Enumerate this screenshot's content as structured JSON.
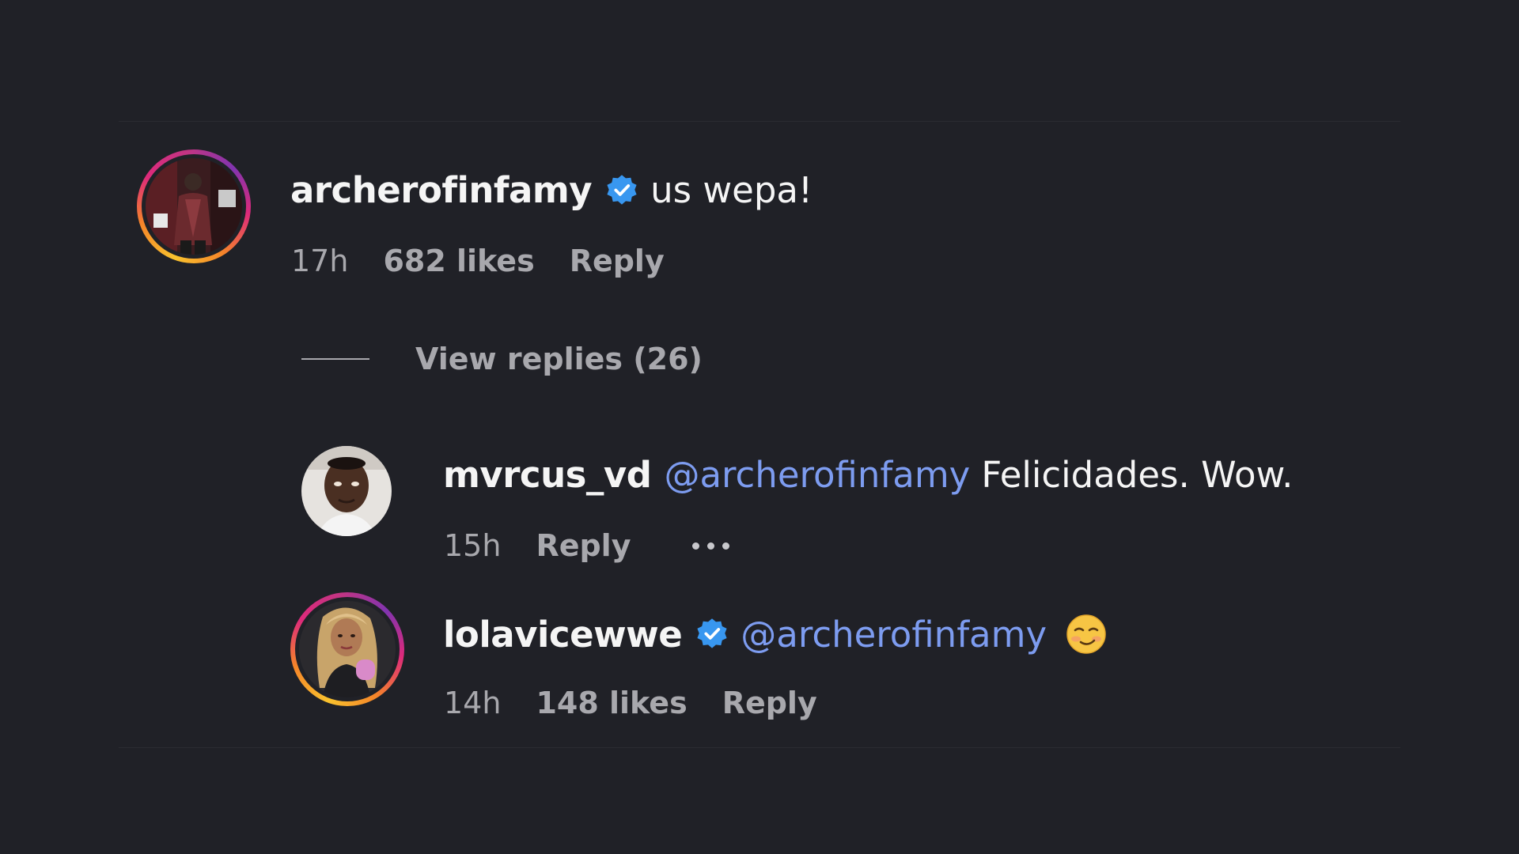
{
  "colors": {
    "background": "#202127",
    "mention": "#7d9cf0",
    "verified": "#3897f0",
    "muted": "#a8a8ad"
  },
  "comments": [
    {
      "username": "archerofinfamy",
      "verified": true,
      "text": "us wepa!",
      "time": "17h",
      "likes": "682 likes",
      "reply_label": "Reply",
      "has_story_ring": true
    }
  ],
  "view_replies": {
    "label": "View replies (26)"
  },
  "replies": [
    {
      "username": "mvrcus_vd",
      "verified": false,
      "mention": "@archerofinfamy",
      "text": "Felicidades. Wow.",
      "time": "15h",
      "reply_label": "Reply",
      "has_more_menu": true,
      "more_icon": "ellipsis-icon"
    },
    {
      "username": "lolavicewwe",
      "verified": true,
      "mention": "@archerofinfamy",
      "emoji_icon": "smirk-emoji-icon",
      "time": "14h",
      "likes": "148 likes",
      "reply_label": "Reply",
      "has_story_ring": true
    }
  ]
}
